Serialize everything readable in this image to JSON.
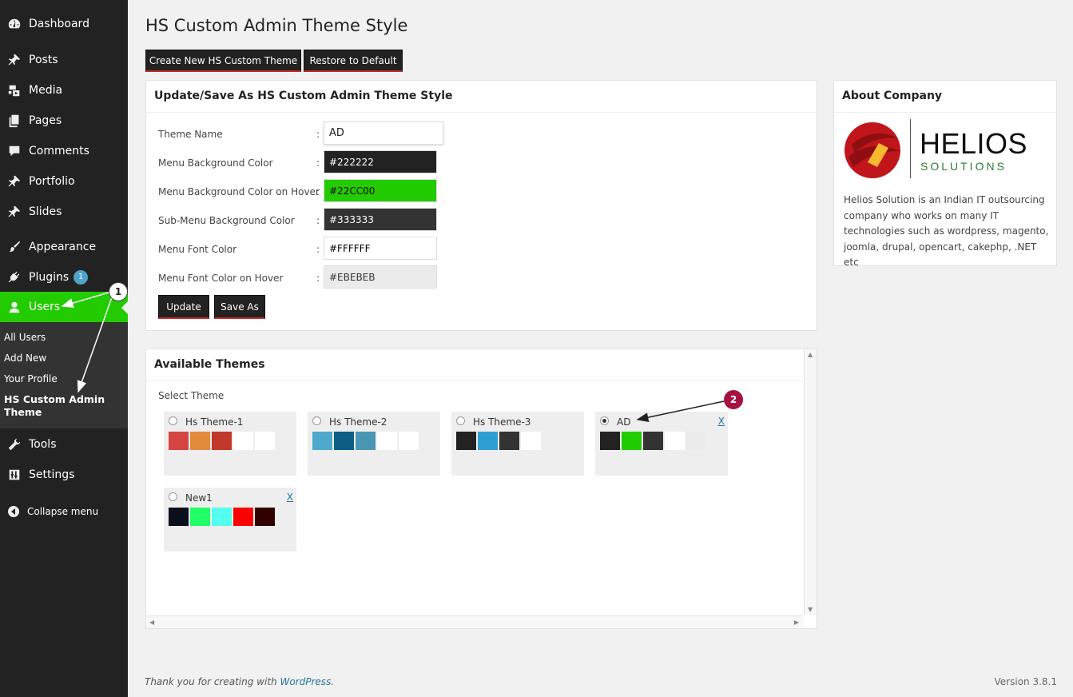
{
  "sidebar": {
    "items": [
      {
        "label": "Dashboard",
        "icon": "dashboard-icon"
      },
      {
        "label": "Posts",
        "icon": "pin-icon"
      },
      {
        "label": "Media",
        "icon": "media-icon"
      },
      {
        "label": "Pages",
        "icon": "pages-icon"
      },
      {
        "label": "Comments",
        "icon": "comment-icon"
      },
      {
        "label": "Portfolio",
        "icon": "portfolio-icon"
      },
      {
        "label": "Slides",
        "icon": "slides-icon"
      },
      {
        "label": "Appearance",
        "icon": "brush-icon"
      },
      {
        "label": "Plugins",
        "icon": "plug-icon",
        "badge": "1"
      },
      {
        "label": "Users",
        "icon": "user-icon"
      },
      {
        "label": "Tools",
        "icon": "wrench-icon"
      },
      {
        "label": "Settings",
        "icon": "settings-icon"
      }
    ],
    "submenu": [
      "All Users",
      "Add New",
      "Your Profile",
      "HS Custom Admin Theme"
    ],
    "collapse_label": "Collapse menu",
    "menu_bg": "#222222",
    "active_bg": "#22CC00",
    "submenu_bg": "#333333"
  },
  "header": {
    "title": "HS Custom Admin Theme Style",
    "create_button": "Create New HS Custom Theme",
    "restore_button": "Restore to Default"
  },
  "form": {
    "title": "Update/Save As HS Custom Admin Theme Style",
    "fields": [
      {
        "label": "Theme Name",
        "value": "AD",
        "bg": "#FFFFFF",
        "fg": "#222222"
      },
      {
        "label": "Menu Background Color",
        "value": "#222222",
        "bg": "#222222",
        "fg": "#FFFFFF"
      },
      {
        "label": "Menu Background Color on Hover",
        "value": "#22CC00",
        "bg": "#22CC00",
        "fg": "#000000"
      },
      {
        "label": "Sub-Menu Background Color",
        "value": "#333333",
        "bg": "#333333",
        "fg": "#FFFFFF"
      },
      {
        "label": "Menu Font Color",
        "value": "#FFFFFF",
        "bg": "#FFFFFF",
        "fg": "#000000"
      },
      {
        "label": "Menu Font Color on Hover",
        "value": "#EBEBEB",
        "bg": "#EBEBEB",
        "fg": "#333333"
      }
    ],
    "colon": ":",
    "update_button": "Update",
    "saveas_button": "Save As"
  },
  "about": {
    "title": "About Company",
    "logo_text": "HELIOS",
    "logo_sub": "SOLUTIONS",
    "description": "Helios Solution is an Indian IT outsourcing company who works on many IT technologies such as wordpress, magento, joomla, drupal, opencart, cakephp, .NET etc"
  },
  "themes": {
    "title": "Available Themes",
    "select_label": "Select Theme",
    "delete_label": "X",
    "list": [
      {
        "name": "Hs Theme-1",
        "selected": false,
        "deletable": false,
        "colors": [
          "#D64541",
          "#E08A3C",
          "#C0392B",
          "#FFFFFF",
          "#FFFFFF"
        ]
      },
      {
        "name": "Hs Theme-2",
        "selected": false,
        "deletable": false,
        "colors": [
          "#4EA9CC",
          "#0E5E84",
          "#4A97B5",
          "#FFFFFF",
          "#FFFFFF"
        ]
      },
      {
        "name": "Hs Theme-3",
        "selected": false,
        "deletable": false,
        "colors": [
          "#222222",
          "#2E9FD3",
          "#333333",
          "#FFFFFF",
          "#EEEEEE"
        ]
      },
      {
        "name": "AD",
        "selected": true,
        "deletable": true,
        "colors": [
          "#222222",
          "#22CC00",
          "#333333",
          "#FFFFFF",
          "#EBEBEB"
        ]
      },
      {
        "name": "New1",
        "selected": false,
        "deletable": true,
        "colors": [
          "#0A0F1E",
          "#22FF66",
          "#55FFEE",
          "#FF0000",
          "#330000"
        ]
      }
    ]
  },
  "callouts": [
    "1",
    "2"
  ],
  "footer": {
    "thanks_prefix": "Thank you for creating with ",
    "thanks_link": "WordPress",
    "thanks_suffix": ".",
    "version": "Version 3.8.1"
  }
}
